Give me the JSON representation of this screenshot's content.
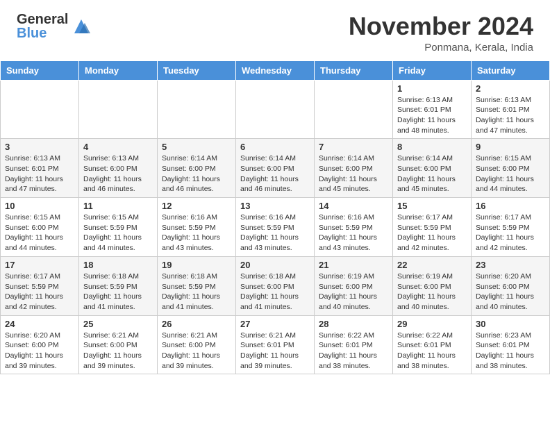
{
  "header": {
    "logo_general": "General",
    "logo_blue": "Blue",
    "month_title": "November 2024",
    "location": "Ponmana, Kerala, India"
  },
  "weekdays": [
    "Sunday",
    "Monday",
    "Tuesday",
    "Wednesday",
    "Thursday",
    "Friday",
    "Saturday"
  ],
  "weeks": [
    [
      {
        "day": "",
        "info": ""
      },
      {
        "day": "",
        "info": ""
      },
      {
        "day": "",
        "info": ""
      },
      {
        "day": "",
        "info": ""
      },
      {
        "day": "",
        "info": ""
      },
      {
        "day": "1",
        "info": "Sunrise: 6:13 AM\nSunset: 6:01 PM\nDaylight: 11 hours\nand 48 minutes."
      },
      {
        "day": "2",
        "info": "Sunrise: 6:13 AM\nSunset: 6:01 PM\nDaylight: 11 hours\nand 47 minutes."
      }
    ],
    [
      {
        "day": "3",
        "info": "Sunrise: 6:13 AM\nSunset: 6:01 PM\nDaylight: 11 hours\nand 47 minutes."
      },
      {
        "day": "4",
        "info": "Sunrise: 6:13 AM\nSunset: 6:00 PM\nDaylight: 11 hours\nand 46 minutes."
      },
      {
        "day": "5",
        "info": "Sunrise: 6:14 AM\nSunset: 6:00 PM\nDaylight: 11 hours\nand 46 minutes."
      },
      {
        "day": "6",
        "info": "Sunrise: 6:14 AM\nSunset: 6:00 PM\nDaylight: 11 hours\nand 46 minutes."
      },
      {
        "day": "7",
        "info": "Sunrise: 6:14 AM\nSunset: 6:00 PM\nDaylight: 11 hours\nand 45 minutes."
      },
      {
        "day": "8",
        "info": "Sunrise: 6:14 AM\nSunset: 6:00 PM\nDaylight: 11 hours\nand 45 minutes."
      },
      {
        "day": "9",
        "info": "Sunrise: 6:15 AM\nSunset: 6:00 PM\nDaylight: 11 hours\nand 44 minutes."
      }
    ],
    [
      {
        "day": "10",
        "info": "Sunrise: 6:15 AM\nSunset: 6:00 PM\nDaylight: 11 hours\nand 44 minutes."
      },
      {
        "day": "11",
        "info": "Sunrise: 6:15 AM\nSunset: 5:59 PM\nDaylight: 11 hours\nand 44 minutes."
      },
      {
        "day": "12",
        "info": "Sunrise: 6:16 AM\nSunset: 5:59 PM\nDaylight: 11 hours\nand 43 minutes."
      },
      {
        "day": "13",
        "info": "Sunrise: 6:16 AM\nSunset: 5:59 PM\nDaylight: 11 hours\nand 43 minutes."
      },
      {
        "day": "14",
        "info": "Sunrise: 6:16 AM\nSunset: 5:59 PM\nDaylight: 11 hours\nand 43 minutes."
      },
      {
        "day": "15",
        "info": "Sunrise: 6:17 AM\nSunset: 5:59 PM\nDaylight: 11 hours\nand 42 minutes."
      },
      {
        "day": "16",
        "info": "Sunrise: 6:17 AM\nSunset: 5:59 PM\nDaylight: 11 hours\nand 42 minutes."
      }
    ],
    [
      {
        "day": "17",
        "info": "Sunrise: 6:17 AM\nSunset: 5:59 PM\nDaylight: 11 hours\nand 42 minutes."
      },
      {
        "day": "18",
        "info": "Sunrise: 6:18 AM\nSunset: 5:59 PM\nDaylight: 11 hours\nand 41 minutes."
      },
      {
        "day": "19",
        "info": "Sunrise: 6:18 AM\nSunset: 5:59 PM\nDaylight: 11 hours\nand 41 minutes."
      },
      {
        "day": "20",
        "info": "Sunrise: 6:18 AM\nSunset: 6:00 PM\nDaylight: 11 hours\nand 41 minutes."
      },
      {
        "day": "21",
        "info": "Sunrise: 6:19 AM\nSunset: 6:00 PM\nDaylight: 11 hours\nand 40 minutes."
      },
      {
        "day": "22",
        "info": "Sunrise: 6:19 AM\nSunset: 6:00 PM\nDaylight: 11 hours\nand 40 minutes."
      },
      {
        "day": "23",
        "info": "Sunrise: 6:20 AM\nSunset: 6:00 PM\nDaylight: 11 hours\nand 40 minutes."
      }
    ],
    [
      {
        "day": "24",
        "info": "Sunrise: 6:20 AM\nSunset: 6:00 PM\nDaylight: 11 hours\nand 39 minutes."
      },
      {
        "day": "25",
        "info": "Sunrise: 6:21 AM\nSunset: 6:00 PM\nDaylight: 11 hours\nand 39 minutes."
      },
      {
        "day": "26",
        "info": "Sunrise: 6:21 AM\nSunset: 6:00 PM\nDaylight: 11 hours\nand 39 minutes."
      },
      {
        "day": "27",
        "info": "Sunrise: 6:21 AM\nSunset: 6:01 PM\nDaylight: 11 hours\nand 39 minutes."
      },
      {
        "day": "28",
        "info": "Sunrise: 6:22 AM\nSunset: 6:01 PM\nDaylight: 11 hours\nand 38 minutes."
      },
      {
        "day": "29",
        "info": "Sunrise: 6:22 AM\nSunset: 6:01 PM\nDaylight: 11 hours\nand 38 minutes."
      },
      {
        "day": "30",
        "info": "Sunrise: 6:23 AM\nSunset: 6:01 PM\nDaylight: 11 hours\nand 38 minutes."
      }
    ]
  ]
}
